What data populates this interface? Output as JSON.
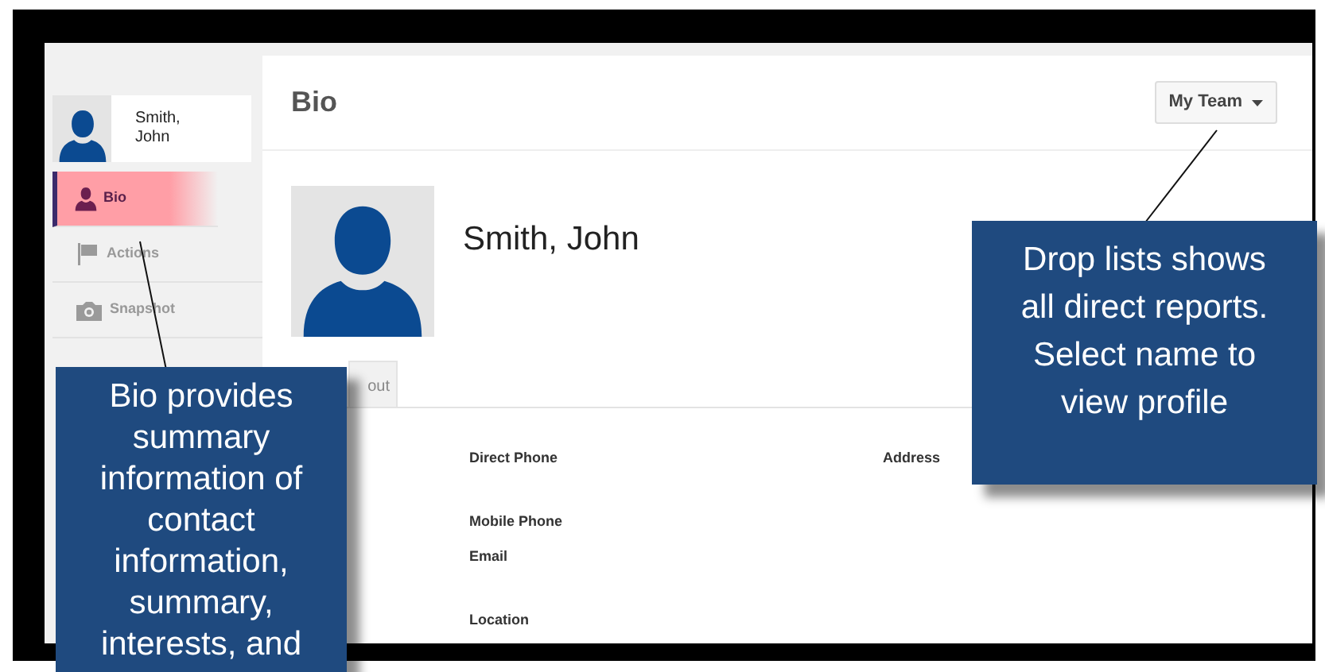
{
  "sidebar": {
    "profile": {
      "name": "Smith, John"
    },
    "items": [
      {
        "label": "Bio",
        "selected": true
      },
      {
        "label": "Actions",
        "selected": false
      },
      {
        "label": "Snapshot",
        "selected": false
      }
    ]
  },
  "header": {
    "title": "Bio",
    "dropdown": "My Team"
  },
  "profile": {
    "name": "Smith, John"
  },
  "tabs": [
    {
      "label": "out"
    }
  ],
  "fields_left": [
    {
      "label": "Direct Phone"
    },
    {
      "label": "Mobile Phone"
    },
    {
      "label": "Email"
    },
    {
      "label": "Location"
    }
  ],
  "fields_right": [
    {
      "label": "Address"
    }
  ],
  "callouts": [
    {
      "text": "Bio provides summary information of contact information, summary, interests, and"
    },
    {
      "text": "Drop lists shows all direct reports.  Select name to view profile"
    }
  ]
}
